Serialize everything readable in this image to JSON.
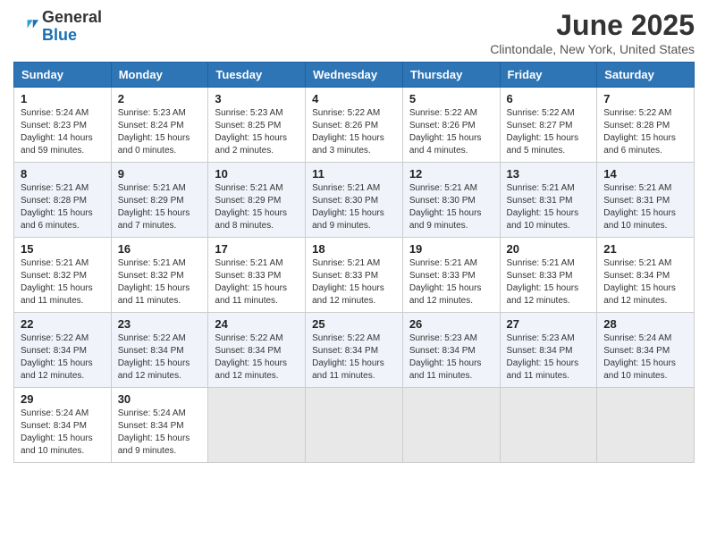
{
  "header": {
    "logo_general": "General",
    "logo_blue": "Blue",
    "month_year": "June 2025",
    "location": "Clintondale, New York, United States"
  },
  "weekdays": [
    "Sunday",
    "Monday",
    "Tuesday",
    "Wednesday",
    "Thursday",
    "Friday",
    "Saturday"
  ],
  "weeks": [
    [
      {
        "day": "1",
        "sunrise": "5:24 AM",
        "sunset": "8:23 PM",
        "daylight": "14 hours and 59 minutes."
      },
      {
        "day": "2",
        "sunrise": "5:23 AM",
        "sunset": "8:24 PM",
        "daylight": "15 hours and 0 minutes."
      },
      {
        "day": "3",
        "sunrise": "5:23 AM",
        "sunset": "8:25 PM",
        "daylight": "15 hours and 2 minutes."
      },
      {
        "day": "4",
        "sunrise": "5:22 AM",
        "sunset": "8:26 PM",
        "daylight": "15 hours and 3 minutes."
      },
      {
        "day": "5",
        "sunrise": "5:22 AM",
        "sunset": "8:26 PM",
        "daylight": "15 hours and 4 minutes."
      },
      {
        "day": "6",
        "sunrise": "5:22 AM",
        "sunset": "8:27 PM",
        "daylight": "15 hours and 5 minutes."
      },
      {
        "day": "7",
        "sunrise": "5:22 AM",
        "sunset": "8:28 PM",
        "daylight": "15 hours and 6 minutes."
      }
    ],
    [
      {
        "day": "8",
        "sunrise": "5:21 AM",
        "sunset": "8:28 PM",
        "daylight": "15 hours and 6 minutes."
      },
      {
        "day": "9",
        "sunrise": "5:21 AM",
        "sunset": "8:29 PM",
        "daylight": "15 hours and 7 minutes."
      },
      {
        "day": "10",
        "sunrise": "5:21 AM",
        "sunset": "8:29 PM",
        "daylight": "15 hours and 8 minutes."
      },
      {
        "day": "11",
        "sunrise": "5:21 AM",
        "sunset": "8:30 PM",
        "daylight": "15 hours and 9 minutes."
      },
      {
        "day": "12",
        "sunrise": "5:21 AM",
        "sunset": "8:30 PM",
        "daylight": "15 hours and 9 minutes."
      },
      {
        "day": "13",
        "sunrise": "5:21 AM",
        "sunset": "8:31 PM",
        "daylight": "15 hours and 10 minutes."
      },
      {
        "day": "14",
        "sunrise": "5:21 AM",
        "sunset": "8:31 PM",
        "daylight": "15 hours and 10 minutes."
      }
    ],
    [
      {
        "day": "15",
        "sunrise": "5:21 AM",
        "sunset": "8:32 PM",
        "daylight": "15 hours and 11 minutes."
      },
      {
        "day": "16",
        "sunrise": "5:21 AM",
        "sunset": "8:32 PM",
        "daylight": "15 hours and 11 minutes."
      },
      {
        "day": "17",
        "sunrise": "5:21 AM",
        "sunset": "8:33 PM",
        "daylight": "15 hours and 11 minutes."
      },
      {
        "day": "18",
        "sunrise": "5:21 AM",
        "sunset": "8:33 PM",
        "daylight": "15 hours and 12 minutes."
      },
      {
        "day": "19",
        "sunrise": "5:21 AM",
        "sunset": "8:33 PM",
        "daylight": "15 hours and 12 minutes."
      },
      {
        "day": "20",
        "sunrise": "5:21 AM",
        "sunset": "8:33 PM",
        "daylight": "15 hours and 12 minutes."
      },
      {
        "day": "21",
        "sunrise": "5:21 AM",
        "sunset": "8:34 PM",
        "daylight": "15 hours and 12 minutes."
      }
    ],
    [
      {
        "day": "22",
        "sunrise": "5:22 AM",
        "sunset": "8:34 PM",
        "daylight": "15 hours and 12 minutes."
      },
      {
        "day": "23",
        "sunrise": "5:22 AM",
        "sunset": "8:34 PM",
        "daylight": "15 hours and 12 minutes."
      },
      {
        "day": "24",
        "sunrise": "5:22 AM",
        "sunset": "8:34 PM",
        "daylight": "15 hours and 12 minutes."
      },
      {
        "day": "25",
        "sunrise": "5:22 AM",
        "sunset": "8:34 PM",
        "daylight": "15 hours and 11 minutes."
      },
      {
        "day": "26",
        "sunrise": "5:23 AM",
        "sunset": "8:34 PM",
        "daylight": "15 hours and 11 minutes."
      },
      {
        "day": "27",
        "sunrise": "5:23 AM",
        "sunset": "8:34 PM",
        "daylight": "15 hours and 11 minutes."
      },
      {
        "day": "28",
        "sunrise": "5:24 AM",
        "sunset": "8:34 PM",
        "daylight": "15 hours and 10 minutes."
      }
    ],
    [
      {
        "day": "29",
        "sunrise": "5:24 AM",
        "sunset": "8:34 PM",
        "daylight": "15 hours and 10 minutes."
      },
      {
        "day": "30",
        "sunrise": "5:24 AM",
        "sunset": "8:34 PM",
        "daylight": "15 hours and 9 minutes."
      },
      null,
      null,
      null,
      null,
      null
    ]
  ]
}
